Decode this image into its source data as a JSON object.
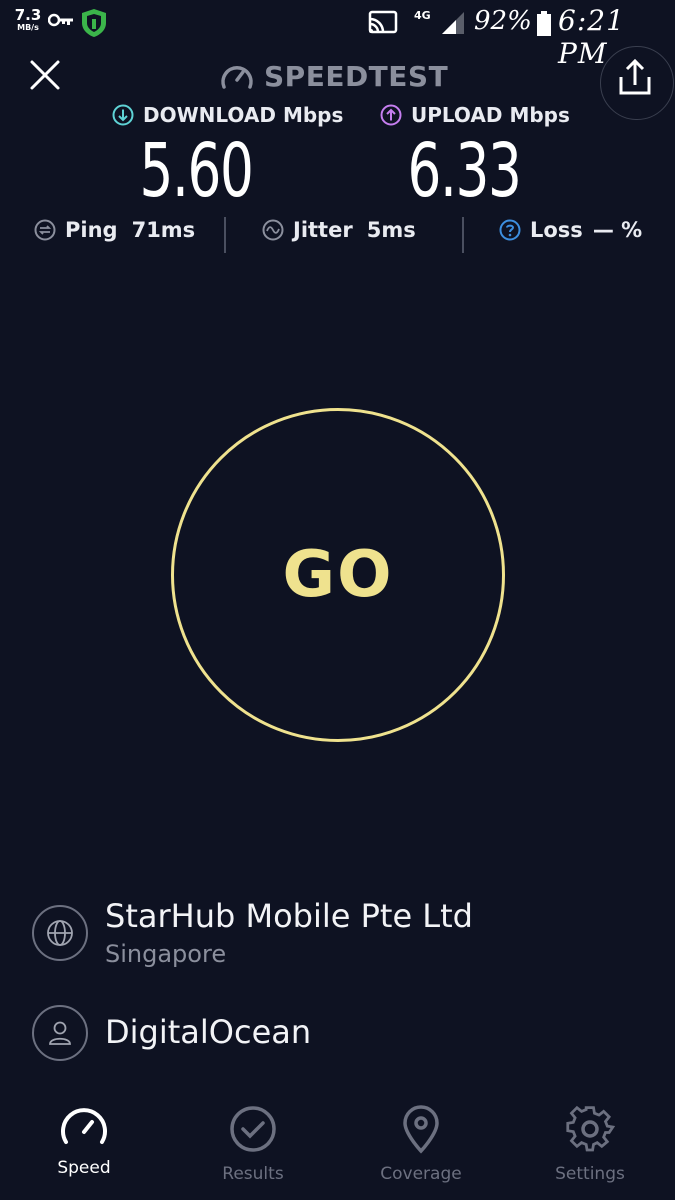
{
  "status_bar": {
    "net_speed_value": "7.3",
    "net_speed_unit": "MB/s",
    "network_type": "4G",
    "battery_percent": "92%",
    "time": "6:21 PM",
    "icons": [
      "key-icon",
      "vpn-shield-icon",
      "cast-icon",
      "signal-icon",
      "battery-icon"
    ]
  },
  "header": {
    "title": "SPEEDTEST"
  },
  "results": {
    "download_label": "DOWNLOAD Mbps",
    "download_value": "5.60",
    "upload_label": "UPLOAD Mbps",
    "upload_value": "6.33",
    "ping_label": "Ping",
    "ping_value": "71ms",
    "jitter_label": "Jitter",
    "jitter_value": "5ms",
    "loss_label": "Loss",
    "loss_value": "— %"
  },
  "go_button": {
    "label": "GO"
  },
  "provider": {
    "isp_name": "StarHub Mobile Pte Ltd",
    "isp_location": "Singapore",
    "server_name": "DigitalOcean"
  },
  "nav": {
    "items": [
      {
        "label": "Speed",
        "icon": "speedometer-icon",
        "active": true
      },
      {
        "label": "Results",
        "icon": "check-circle-icon",
        "active": false
      },
      {
        "label": "Coverage",
        "icon": "map-pin-icon",
        "active": false
      },
      {
        "label": "Settings",
        "icon": "gear-icon",
        "active": false
      }
    ]
  },
  "colors": {
    "background": "#0e1222",
    "go_accent": "#efe28e",
    "download_accent": "#5fd3d6",
    "upload_accent": "#c67ef0",
    "loss_accent": "#3d8fe0",
    "vpn_green": "#3bb54a"
  }
}
